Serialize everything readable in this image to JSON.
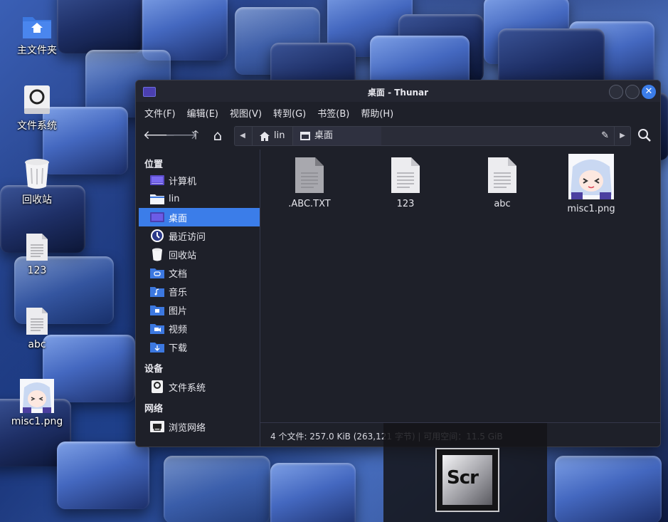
{
  "desktop": {
    "icons": [
      {
        "label": "主文件夹",
        "icon": "home-folder-icon"
      },
      {
        "label": "文件系统",
        "icon": "drive-icon"
      },
      {
        "label": "回收站",
        "icon": "trash-icon"
      },
      {
        "label": "123",
        "icon": "text-file-icon"
      },
      {
        "label": "abc",
        "icon": "text-file-icon"
      },
      {
        "label": "misc1.png",
        "icon": "image-thumbnail-icon"
      }
    ]
  },
  "window": {
    "title": "桌面 - Thunar",
    "close_glyph": "✕"
  },
  "menubar": [
    "文件(F)",
    "编辑(E)",
    "视图(V)",
    "转到(G)",
    "书签(B)",
    "帮助(H)"
  ],
  "toolbar": {
    "back": "🡐",
    "forward": "🡒",
    "up": "🡑",
    "home": "⌂",
    "path": [
      "lin",
      "桌面"
    ],
    "edit_icon": "pencil-icon",
    "search_icon": "search-icon"
  },
  "sidebar": {
    "sections": [
      {
        "title": "位置",
        "items": [
          {
            "label": "计算机",
            "icon": "computer-icon"
          },
          {
            "label": "lin",
            "icon": "home-folder-icon"
          },
          {
            "label": "桌面",
            "icon": "desktop-icon",
            "selected": true
          },
          {
            "label": "最近访问",
            "icon": "recent-icon"
          },
          {
            "label": "回收站",
            "icon": "trash-icon"
          },
          {
            "label": "文档",
            "icon": "documents-folder-icon"
          },
          {
            "label": "音乐",
            "icon": "music-folder-icon"
          },
          {
            "label": "图片",
            "icon": "pictures-folder-icon"
          },
          {
            "label": "视频",
            "icon": "videos-folder-icon"
          },
          {
            "label": "下载",
            "icon": "downloads-folder-icon"
          }
        ]
      },
      {
        "title": "设备",
        "items": [
          {
            "label": "文件系统",
            "icon": "drive-icon"
          }
        ]
      },
      {
        "title": "网络",
        "items": [
          {
            "label": "浏览网络",
            "icon": "network-icon"
          }
        ]
      }
    ]
  },
  "files": [
    {
      "name": ".ABC.TXT",
      "icon": "text-file-icon"
    },
    {
      "name": "123",
      "icon": "text-file-icon"
    },
    {
      "name": "abc",
      "icon": "text-file-icon"
    },
    {
      "name": "misc1.png",
      "icon": "image-thumbnail-icon"
    }
  ],
  "status": "4 个文件: 257.0 KiB (263,121 字节) | 可用空间：11.5 GiB",
  "overlay": {
    "logo_text": "Scr"
  },
  "colors": {
    "accent": "#3b7de9",
    "window_bg": "#1e2029",
    "folder": "#3c78e0"
  }
}
